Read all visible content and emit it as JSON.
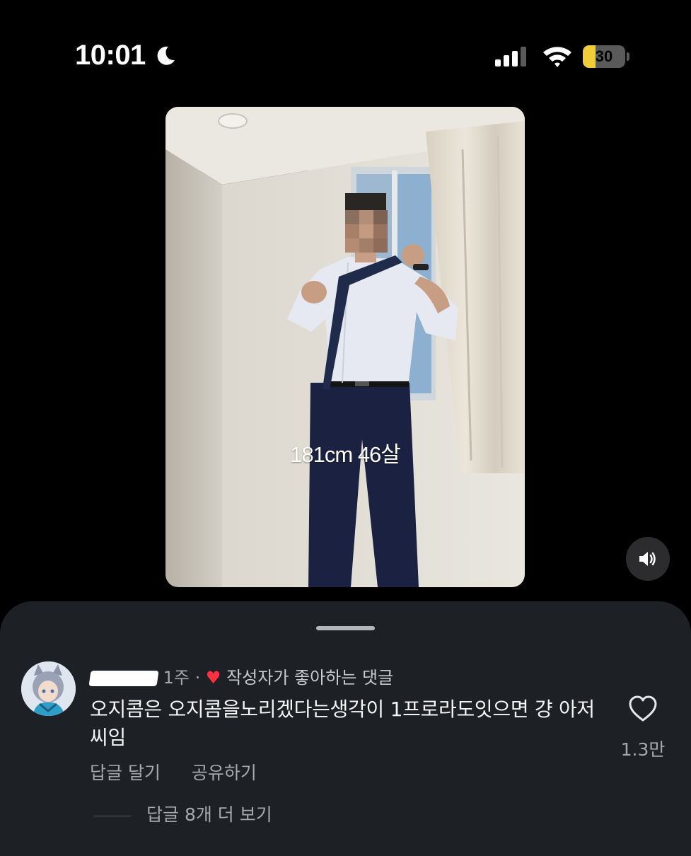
{
  "status_bar": {
    "time": "10:01",
    "focus_icon": "moon-icon",
    "battery_level": "30",
    "battery_fraction": 0.3,
    "accent": "#f1cd3c"
  },
  "video": {
    "overlay_caption": "181cm 46살",
    "sound_icon": "speaker-icon"
  },
  "comment": {
    "age": "1주",
    "separator": "·",
    "liked_by_author": "작성자가 좋아하는 댓글",
    "body": "오지콤은 오지콤을노리겠다는생각이 1프로라도잇으면 걍 아저씨임",
    "like_count": "1.3만",
    "heart_color": "#ff3040",
    "actions": {
      "reply": "답글 달기",
      "share": "공유하기"
    },
    "view_replies": "답글 8개 더 보기"
  }
}
